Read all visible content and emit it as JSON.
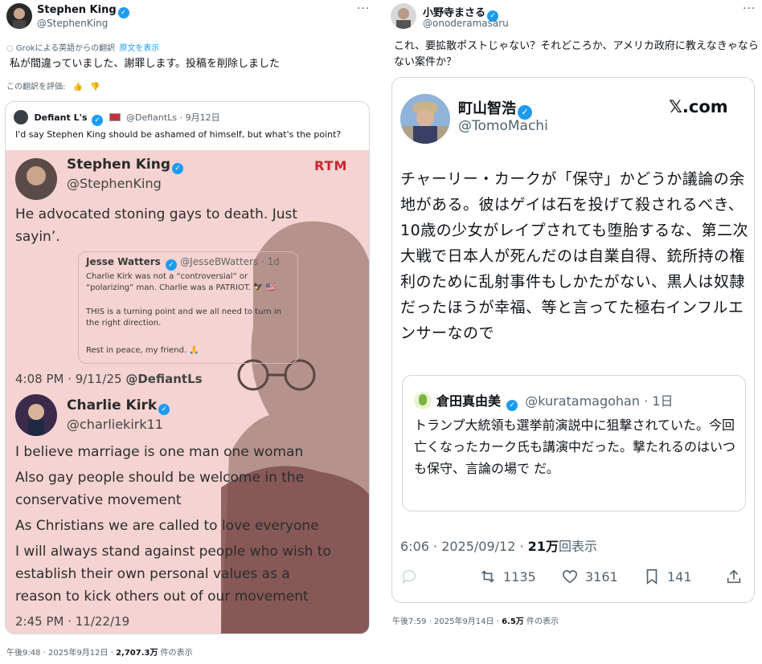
{
  "left_post": {
    "author": "Stephen King",
    "handle": "@StephenKing",
    "translation_notice": "Grokによる英語からの翻訳",
    "show_original": "原文を表示",
    "text": "私が間違っていました、謝罪します。投稿を削除しました",
    "rate_translation": "この翻訳を評価:",
    "quote": {
      "author": "Defiant L's",
      "handle": "@DefiantLs",
      "date": "9月12日",
      "text": "I'd say Stephen King should be ashamed of himself, but what's the point?",
      "image": {
        "brand": "RTM",
        "sk_name": "Stephen King",
        "sk_handle": "@StephenKing",
        "sk_text_1": "He advocated stoning gays to death. Just",
        "sk_text_2": "sayin’.",
        "jw_name": "Jesse Watters",
        "jw_handle": "@JesseBWatters · 1d",
        "jw_line_1": "Charlie Kirk was not a “controversial” or",
        "jw_line_2": "“polarizing” man. Charlie was a PATRIOT. 🦅 🇺🇸",
        "jw_line_3": "THIS is a turning point and we all need to turn in",
        "jw_line_4": "the right direction.",
        "jw_line_5": "Rest in peace, my friend. 🙏",
        "stamp_1": "4:08 PM · 9/11/25",
        "stamp_1_handle": "@DefiantLs",
        "ck_name": "Charlie Kirk",
        "ck_handle": "@charliekirk11",
        "ck_line_1": "I believe marriage is one man one woman",
        "ck_line_2": "Also gay people should be welcome in the",
        "ck_line_3": "conservative movement",
        "ck_line_4": "As Christians we are called to love everyone",
        "ck_line_5": "I will always stand against people who wish to",
        "ck_line_6": "establish their own personal values as a",
        "ck_line_7": "reason to kick others out of our movement",
        "stamp_2": "2:45 PM · 11/22/19"
      }
    },
    "footer_time": "午後9:48 · 2025年9月12日 · ",
    "footer_views": "2,707.3万",
    "footer_views_label": " 件の表示"
  },
  "right_post": {
    "author": "小野寺まさる",
    "handle": "@onoderamasaru",
    "text": "これ、要拡散ポストじゃない？それどころか、アメリカ政府に教えなきゃならない案件か？",
    "card": {
      "author": "町山智浩",
      "handle": "@TomoMachi",
      "brand": "𝕏.com",
      "body": "チャーリー・カークが「保守」かどうか議論の余地がある。彼はゲイは石を投げて殺されるべき、10歳の少女がレイプされても堕胎するな、第二次大戦で日本人が死んだのは自業自得、銃所持の権利のために乱射事件もしかたがない、黒人は奴隷だったほうが幸福、等と言ってた極右インフルエンサーなので",
      "quote_author": "倉田真由美",
      "quote_handle": "@kuratamagohan · 1日",
      "quote_body": "トランプ大統領も選挙前演説中に狙撃されていた。今回亡くなったカーク氏も講演中だった。撃たれるのはいつも保守、言論の場で だ。",
      "time": "6:06 · 2025/09/12 · ",
      "views": "21万",
      "views_label": "回表示",
      "retweets": "1135",
      "likes": "3161",
      "bookmarks": "141"
    },
    "footer_time": "午後7:59 · 2025年9月14日 · ",
    "footer_views": "6.5万",
    "footer_views_label": " 件の表示"
  },
  "colors": {
    "accent": "#1d9bf0",
    "muted": "#536471",
    "image_bg": "#f4d3d2",
    "rtm": "#c8262f"
  }
}
